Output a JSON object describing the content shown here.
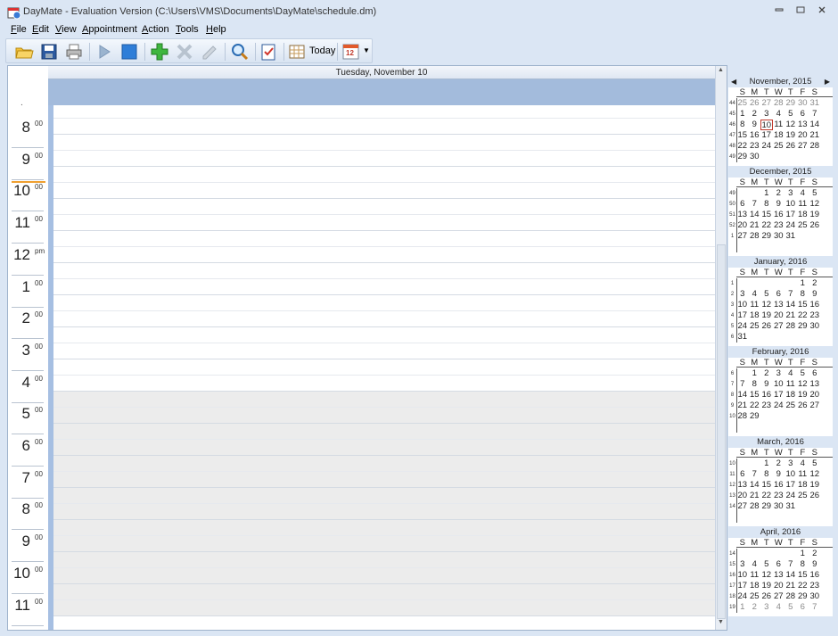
{
  "window": {
    "title": "DayMate - Evaluation Version (C:\\Users\\VMS\\Documents\\DayMate\\schedule.dm)",
    "minimize": "▭",
    "maximize": "▢",
    "close": "✕"
  },
  "menu": [
    "File",
    "Edit",
    "View",
    "Appointment",
    "Action",
    "Tools",
    "Help"
  ],
  "menu_mnemonics": [
    "F",
    "E",
    "V",
    "A",
    "A",
    "T",
    "H"
  ],
  "toolbar": {
    "today_label": "Today",
    "calendar_badge": "12",
    "icons": [
      "open-folder-icon",
      "save-disk-icon",
      "print-icon",
      "play-icon",
      "stop-icon",
      "add-icon",
      "delete-icon",
      "edit-icon",
      "search-icon",
      "tasks-icon",
      "today-grid-icon",
      "calendar-icon",
      "dropdown-arrow-icon"
    ]
  },
  "day_view": {
    "date_header": "Tuesday, November 10",
    "allday_dot": ".",
    "hours": [
      {
        "h": "8",
        "m": "00"
      },
      {
        "h": "9",
        "m": "00"
      },
      {
        "h": "10",
        "m": "00"
      },
      {
        "h": "11",
        "m": "00"
      },
      {
        "h": "12",
        "m": "pm"
      },
      {
        "h": "1",
        "m": "00"
      },
      {
        "h": "2",
        "m": "00"
      },
      {
        "h": "3",
        "m": "00"
      },
      {
        "h": "4",
        "m": "00"
      },
      {
        "h": "5",
        "m": "00"
      },
      {
        "h": "6",
        "m": "00"
      },
      {
        "h": "7",
        "m": "00"
      },
      {
        "h": "8",
        "m": "00"
      },
      {
        "h": "9",
        "m": "00"
      },
      {
        "h": "10",
        "m": "00"
      },
      {
        "h": "11",
        "m": "00"
      }
    ]
  },
  "calendar": {
    "dow": [
      "S",
      "M",
      "T",
      "W",
      "T",
      "F",
      "S"
    ],
    "months": [
      {
        "title": "November, 2015",
        "weeks": [
          "44",
          "45",
          "46",
          "47",
          "48",
          "49"
        ],
        "days": [
          [
            "25",
            "26",
            "27",
            "28",
            "29",
            "30",
            "31"
          ],
          [
            "1",
            "2",
            "3",
            "4",
            "5",
            "6",
            "7"
          ],
          [
            "8",
            "9",
            "10",
            "11",
            "12",
            "13",
            "14"
          ],
          [
            "15",
            "16",
            "17",
            "18",
            "19",
            "20",
            "21"
          ],
          [
            "22",
            "23",
            "24",
            "25",
            "26",
            "27",
            "28"
          ],
          [
            "29",
            "30",
            "",
            "",
            "",
            "",
            ""
          ]
        ],
        "grey_rows": [
          0
        ],
        "today": [
          2,
          2
        ]
      },
      {
        "title": "December, 2015",
        "weeks": [
          "49",
          "50",
          "51",
          "52",
          "1",
          ""
        ],
        "days": [
          [
            "",
            "",
            "1",
            "2",
            "3",
            "4",
            "5"
          ],
          [
            "6",
            "7",
            "8",
            "9",
            "10",
            "11",
            "12"
          ],
          [
            "13",
            "14",
            "15",
            "16",
            "17",
            "18",
            "19"
          ],
          [
            "20",
            "21",
            "22",
            "23",
            "24",
            "25",
            "26"
          ],
          [
            "27",
            "28",
            "29",
            "30",
            "31",
            "",
            ""
          ],
          [
            "",
            "",
            "",
            "",
            "",
            "",
            ""
          ]
        ]
      },
      {
        "title": "January, 2016",
        "weeks": [
          "1",
          "2",
          "3",
          "4",
          "5",
          "6"
        ],
        "days": [
          [
            "",
            "",
            "",
            "",
            "",
            "1",
            "2"
          ],
          [
            "3",
            "4",
            "5",
            "6",
            "7",
            "8",
            "9"
          ],
          [
            "10",
            "11",
            "12",
            "13",
            "14",
            "15",
            "16"
          ],
          [
            "17",
            "18",
            "19",
            "20",
            "21",
            "22",
            "23"
          ],
          [
            "24",
            "25",
            "26",
            "27",
            "28",
            "29",
            "30"
          ],
          [
            "31",
            "",
            "",
            "",
            "",
            "",
            ""
          ]
        ]
      },
      {
        "title": "February, 2016",
        "weeks": [
          "6",
          "7",
          "8",
          "9",
          "10",
          ""
        ],
        "days": [
          [
            "",
            "1",
            "2",
            "3",
            "4",
            "5",
            "6"
          ],
          [
            "7",
            "8",
            "9",
            "10",
            "11",
            "12",
            "13"
          ],
          [
            "14",
            "15",
            "16",
            "17",
            "18",
            "19",
            "20"
          ],
          [
            "21",
            "22",
            "23",
            "24",
            "25",
            "26",
            "27"
          ],
          [
            "28",
            "29",
            "",
            "",
            "",
            "",
            ""
          ],
          [
            "",
            "",
            "",
            "",
            "",
            "",
            ""
          ]
        ]
      },
      {
        "title": "March, 2016",
        "weeks": [
          "10",
          "11",
          "12",
          "13",
          "14",
          ""
        ],
        "days": [
          [
            "",
            "",
            "1",
            "2",
            "3",
            "4",
            "5"
          ],
          [
            "6",
            "7",
            "8",
            "9",
            "10",
            "11",
            "12"
          ],
          [
            "13",
            "14",
            "15",
            "16",
            "17",
            "18",
            "19"
          ],
          [
            "20",
            "21",
            "22",
            "23",
            "24",
            "25",
            "26"
          ],
          [
            "27",
            "28",
            "29",
            "30",
            "31",
            "",
            ""
          ],
          [
            "",
            "",
            "",
            "",
            "",
            "",
            ""
          ]
        ]
      },
      {
        "title": "April, 2016",
        "weeks": [
          "14",
          "15",
          "16",
          "17",
          "18",
          "19"
        ],
        "days": [
          [
            "",
            "",
            "",
            "",
            "",
            "1",
            "2"
          ],
          [
            "3",
            "4",
            "5",
            "6",
            "7",
            "8",
            "9"
          ],
          [
            "10",
            "11",
            "12",
            "13",
            "14",
            "15",
            "16"
          ],
          [
            "17",
            "18",
            "19",
            "20",
            "21",
            "22",
            "23"
          ],
          [
            "24",
            "25",
            "26",
            "27",
            "28",
            "29",
            "30"
          ],
          [
            "1",
            "2",
            "3",
            "4",
            "5",
            "6",
            "7"
          ]
        ],
        "grey_rows": [
          5
        ]
      }
    ]
  }
}
